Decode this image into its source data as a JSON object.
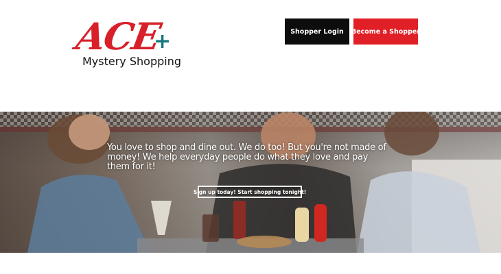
{
  "logo": {
    "mark": "ACE",
    "plus": "+",
    "tagline": "Mystery Shopping"
  },
  "nav": {
    "login_label": "Shopper Login",
    "signup_label": "Become a Shopper"
  },
  "hero": {
    "headline": "You love to shop and dine out. We do too! But you're not made of money!  We help everyday people do what they love and pay them for it!",
    "cta_label": "Sign up today! Start shopping tonight!"
  },
  "colors": {
    "brand_red": "#e01f26",
    "brand_teal": "#14787e",
    "login_button": "#0d0d0d"
  }
}
